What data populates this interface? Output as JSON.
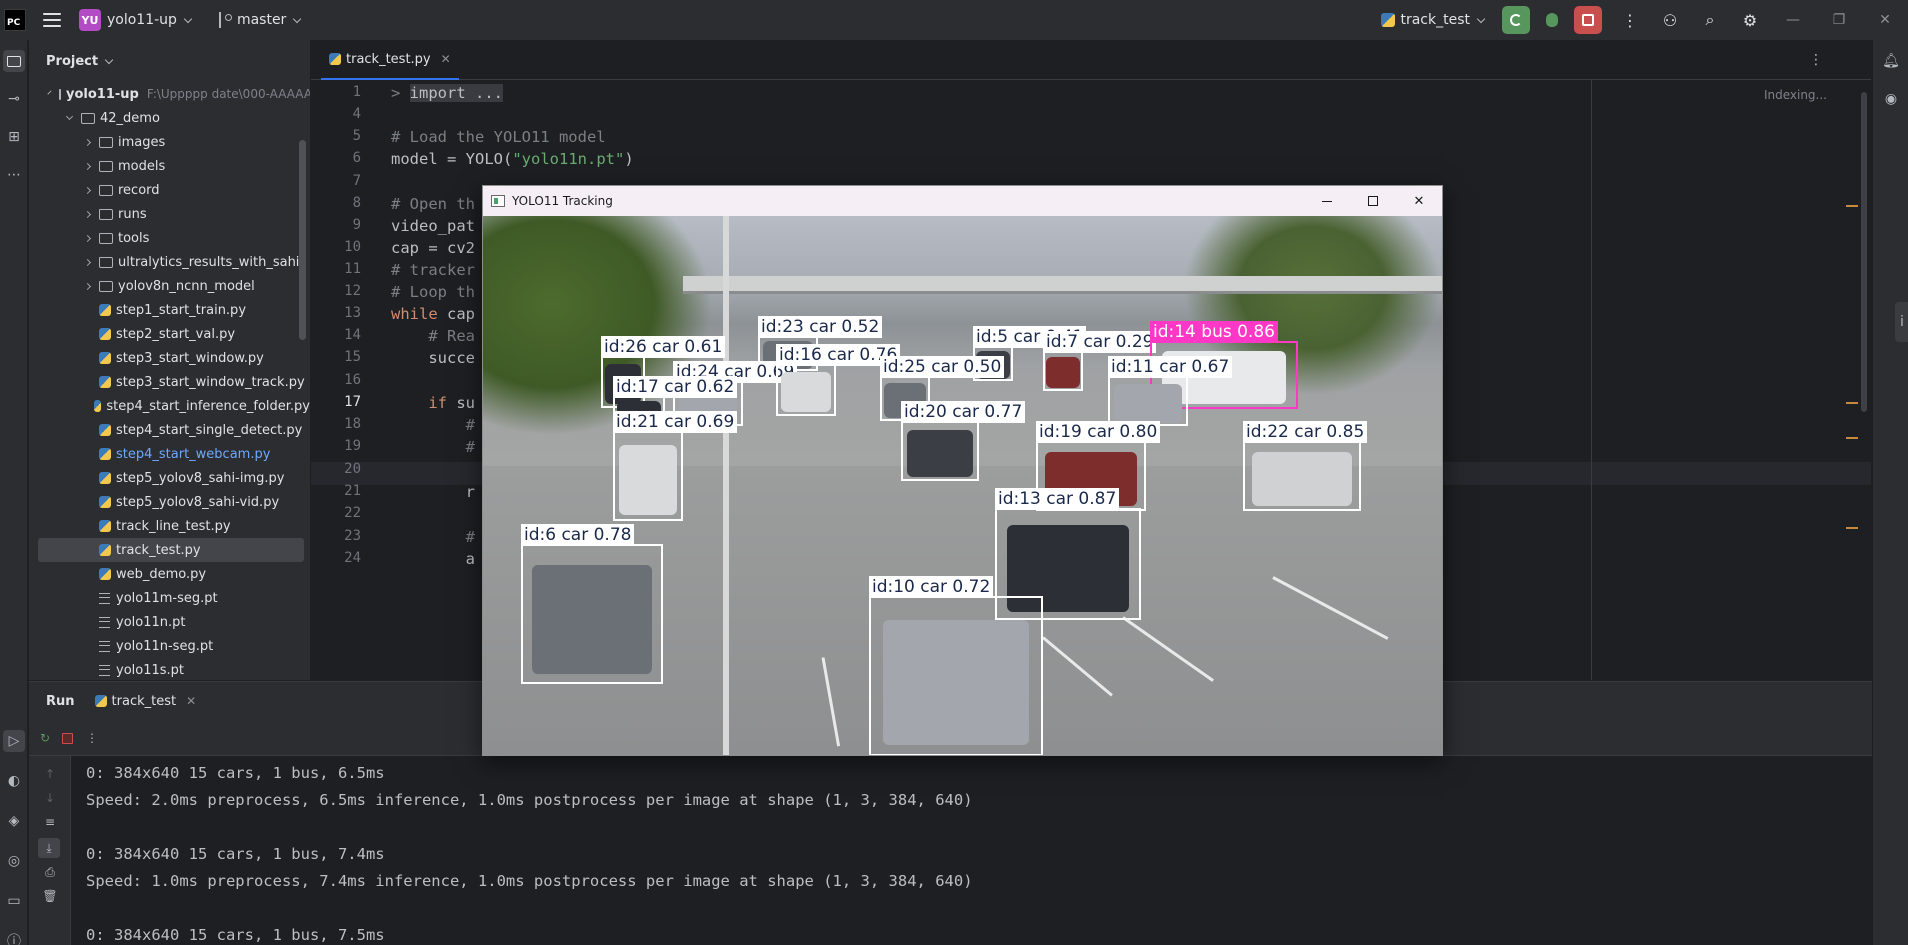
{
  "titlebar": {
    "app_logo": "PC",
    "project_initials": "YU",
    "project_name": "yolo11-up",
    "branch": "master",
    "run_config": "track_test",
    "icons": [
      "menu-icon",
      "branch-icon",
      "rerun-icon",
      "debug-icon",
      "stop-icon",
      "more-icon",
      "add-user-icon",
      "search-icon",
      "gear-icon",
      "minimize-icon",
      "restore-icon",
      "close-icon"
    ]
  },
  "project": {
    "title": "Project",
    "root": {
      "name": "yolo11-up",
      "path": "F:\\Uppppp date\\000-AAAAA"
    },
    "items": [
      {
        "label": "42_demo",
        "type": "folder",
        "level": 1,
        "open": true
      },
      {
        "label": "images",
        "type": "folder",
        "level": 2
      },
      {
        "label": "models",
        "type": "folder",
        "level": 2
      },
      {
        "label": "record",
        "type": "folder",
        "level": 2
      },
      {
        "label": "runs",
        "type": "folder",
        "level": 2
      },
      {
        "label": "tools",
        "type": "folder",
        "level": 2
      },
      {
        "label": "ultralytics_results_with_sahi",
        "type": "folder",
        "level": 2
      },
      {
        "label": "yolov8n_ncnn_model",
        "type": "folder",
        "level": 2
      },
      {
        "label": "step1_start_train.py",
        "type": "py",
        "level": 2
      },
      {
        "label": "step2_start_val.py",
        "type": "py",
        "level": 2
      },
      {
        "label": "step3_start_window.py",
        "type": "py",
        "level": 2
      },
      {
        "label": "step3_start_window_track.py",
        "type": "py",
        "level": 2
      },
      {
        "label": "step4_start_inference_folder.py",
        "type": "py",
        "level": 2
      },
      {
        "label": "step4_start_single_detect.py",
        "type": "py",
        "level": 2
      },
      {
        "label": "step4_start_webcam.py",
        "type": "py",
        "level": 2,
        "highlight": true
      },
      {
        "label": "step5_yolov8_sahi-img.py",
        "type": "py",
        "level": 2
      },
      {
        "label": "step5_yolov8_sahi-vid.py",
        "type": "py",
        "level": 2
      },
      {
        "label": "track_line_test.py",
        "type": "py",
        "level": 2
      },
      {
        "label": "track_test.py",
        "type": "py",
        "level": 2,
        "selected": true
      },
      {
        "label": "web_demo.py",
        "type": "py",
        "level": 2
      },
      {
        "label": "yolo11m-seg.pt",
        "type": "pt",
        "level": 2
      },
      {
        "label": "yolo11n.pt",
        "type": "pt",
        "level": 2
      },
      {
        "label": "yolo11n-seg.pt",
        "type": "pt",
        "level": 2
      },
      {
        "label": "yolo11s.pt",
        "type": "pt",
        "level": 2
      }
    ]
  },
  "editor": {
    "tab": "track_test.py",
    "status": "Indexing...",
    "current_line": "17",
    "lines": [
      {
        "n": "1",
        "html_key": "l1"
      },
      {
        "n": "4",
        "html_key": "l4"
      },
      {
        "n": "5",
        "html_key": "l5"
      },
      {
        "n": "6",
        "html_key": "l6"
      },
      {
        "n": "7",
        "html_key": "l7"
      },
      {
        "n": "8",
        "html_key": "l8"
      },
      {
        "n": "9",
        "html_key": "l9"
      },
      {
        "n": "10",
        "html_key": "l10"
      },
      {
        "n": "11",
        "html_key": "l11"
      },
      {
        "n": "12",
        "html_key": "l12"
      },
      {
        "n": "13",
        "html_key": "l13"
      },
      {
        "n": "14",
        "html_key": "l14"
      },
      {
        "n": "15",
        "html_key": "l15"
      },
      {
        "n": "16",
        "html_key": "l16"
      },
      {
        "n": "17",
        "html_key": "l17"
      },
      {
        "n": "18",
        "html_key": "l18"
      },
      {
        "n": "19",
        "html_key": "l19"
      },
      {
        "n": "20",
        "html_key": "l20"
      },
      {
        "n": "21",
        "html_key": "l21"
      },
      {
        "n": "22",
        "html_key": "l22"
      },
      {
        "n": "23",
        "html_key": "l23"
      },
      {
        "n": "24",
        "html_key": "l24"
      }
    ],
    "code": {
      "import_fold": "import ...",
      "c5": "# Load the YOLO11 model",
      "c6a": "model = YOLO(",
      "c6s": "\"yolo11n.pt\"",
      "c6b": ")",
      "c8": "# Open th",
      "c9": "video_pat",
      "c10": "cap = cv2",
      "c11": "# tracker",
      "c12": "# Loop th",
      "c13kw": "while",
      "c13": " cap",
      "c14": "    # Rea",
      "c15": "    succe",
      "c17kw": "    if",
      "c17": " su",
      "c18": "        #",
      "c19": "        #",
      "c21": "        r",
      "c23": "        #",
      "c24": "        a"
    }
  },
  "run": {
    "title": "Run",
    "tab": "track_test",
    "console": [
      "0: 384x640 15 cars, 1 bus, 6.5ms",
      "Speed: 2.0ms preprocess, 6.5ms inference, 1.0ms postprocess per image at shape (1, 3, 384, 640)",
      "",
      "0: 384x640 15 cars, 1 bus, 7.4ms",
      "Speed: 1.0ms preprocess, 7.4ms inference, 1.0ms postprocess per image at shape (1, 3, 384, 640)",
      "",
      "0: 384x640 15 cars, 1 bus, 7.5ms"
    ]
  },
  "yolo_window": {
    "title": "YOLO11 Tracking",
    "detections": [
      {
        "label": "id:26 car 0.61",
        "kind": "car"
      },
      {
        "label": "id:23 car 0.52",
        "kind": "car"
      },
      {
        "label": "id:24 car 0.69",
        "kind": "car"
      },
      {
        "label": "id:16 car 0.76",
        "kind": "car"
      },
      {
        "label": "id:5 car 0.41",
        "kind": "car"
      },
      {
        "label": "id:7 car 0.29",
        "kind": "car"
      },
      {
        "label": "id:14 bus 0.86",
        "kind": "bus"
      },
      {
        "label": "id:17 car 0.62",
        "kind": "car"
      },
      {
        "label": "id:25 car 0.50",
        "kind": "car"
      },
      {
        "label": "id:11 car 0.67",
        "kind": "car"
      },
      {
        "label": "id:21 car 0.69",
        "kind": "car"
      },
      {
        "label": "id:20 car 0.77",
        "kind": "car"
      },
      {
        "label": "id:19 car 0.80",
        "kind": "car"
      },
      {
        "label": "id:22 car 0.85",
        "kind": "car"
      },
      {
        "label": "id:13 car 0.87",
        "kind": "car"
      },
      {
        "label": "id:6 car 0.78",
        "kind": "car"
      },
      {
        "label": "id:10 car 0.72",
        "kind": "car"
      }
    ]
  }
}
